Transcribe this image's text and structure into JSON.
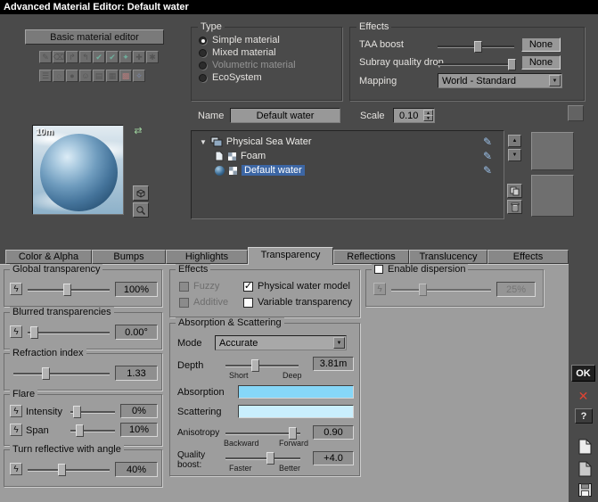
{
  "window": {
    "title": "Advanced Material Editor: Default water"
  },
  "left_toolbar": {
    "basic_button": "Basic material editor",
    "preview_size_label": "10m"
  },
  "type_group": {
    "title": "Type",
    "options": [
      {
        "label": "Simple material"
      },
      {
        "label": "Mixed material"
      },
      {
        "label": "Volumetric material"
      },
      {
        "label": "EcoSystem"
      }
    ]
  },
  "effects_group": {
    "title": "Effects",
    "taa_label": "TAA boost",
    "taa_value": "None",
    "subray_label": "Subray quality drop",
    "subray_value": "None",
    "mapping_label": "Mapping",
    "mapping_value": "World - Standard"
  },
  "name_row": {
    "name_label": "Name",
    "name_value": "Default water",
    "scale_label": "Scale",
    "scale_value": "0.10"
  },
  "tree": {
    "root": "Physical Sea Water",
    "child1": "Foam",
    "child2": "Default water"
  },
  "tabs": {
    "active": "Transparency",
    "items": [
      {
        "label": "Color & Alpha"
      },
      {
        "label": "Bumps"
      },
      {
        "label": "Highlights"
      },
      {
        "label": "Transparency"
      },
      {
        "label": "Reflections"
      },
      {
        "label": "Translucency"
      },
      {
        "label": "Effects"
      }
    ]
  },
  "panel": {
    "global": {
      "title": "Global transparency",
      "value": "100%"
    },
    "blurred": {
      "title": "Blurred transparencies",
      "value": "0.00°"
    },
    "refraction": {
      "title": "Refraction index",
      "value": "1.33"
    },
    "flare": {
      "title": "Flare",
      "intensity_label": "Intensity",
      "intensity_value": "0%",
      "span_label": "Span",
      "span_value": "10%"
    },
    "turn": {
      "title": "Turn reflective with angle",
      "value": "40%"
    },
    "effects": {
      "title": "Effects",
      "fuzzy": "Fuzzy",
      "additive": "Additive",
      "physical": "Physical water model",
      "variable": "Variable transparency"
    },
    "abs": {
      "title": "Absorption & Scattering",
      "mode_label": "Mode",
      "mode_value": "Accurate",
      "depth_label": "Depth",
      "depth_min": "Short",
      "depth_max": "Deep",
      "depth_value": "3.81m",
      "absorption_label": "Absorption",
      "absorption_color": "#86d7f8",
      "scattering_label": "Scattering",
      "scattering_color": "#c9effd",
      "aniso_label": "Anisotropy",
      "aniso_min": "Backward",
      "aniso_max": "Forward",
      "aniso_value": "0.90",
      "quality_label": "Quality boost:",
      "quality_min": "Faster",
      "quality_max": "Better",
      "quality_value": "+4.0"
    },
    "dispersion": {
      "title": "Enable dispersion",
      "value": "25%"
    }
  },
  "rail": {
    "ok": "OK",
    "help": "?"
  },
  "icons": {
    "lightning": "ϟ",
    "dropdown_arrow": "▼",
    "spinner_up": "▲",
    "spinner_down": "▼",
    "arrow_up": "▲",
    "arrow_down": "▼",
    "tree_expander": "▼",
    "pen": "✎",
    "check": "✓",
    "cancel": "✕",
    "swap": "⇄",
    "toolbar_row1": [
      "✎",
      "⌫",
      "↱",
      "↰",
      "✔",
      "✔",
      "✦",
      "✚",
      "✱"
    ],
    "toolbar_row2": [
      "☰",
      "◌",
      "●",
      "☺",
      "▤",
      "▦",
      "▩",
      "✧"
    ]
  }
}
